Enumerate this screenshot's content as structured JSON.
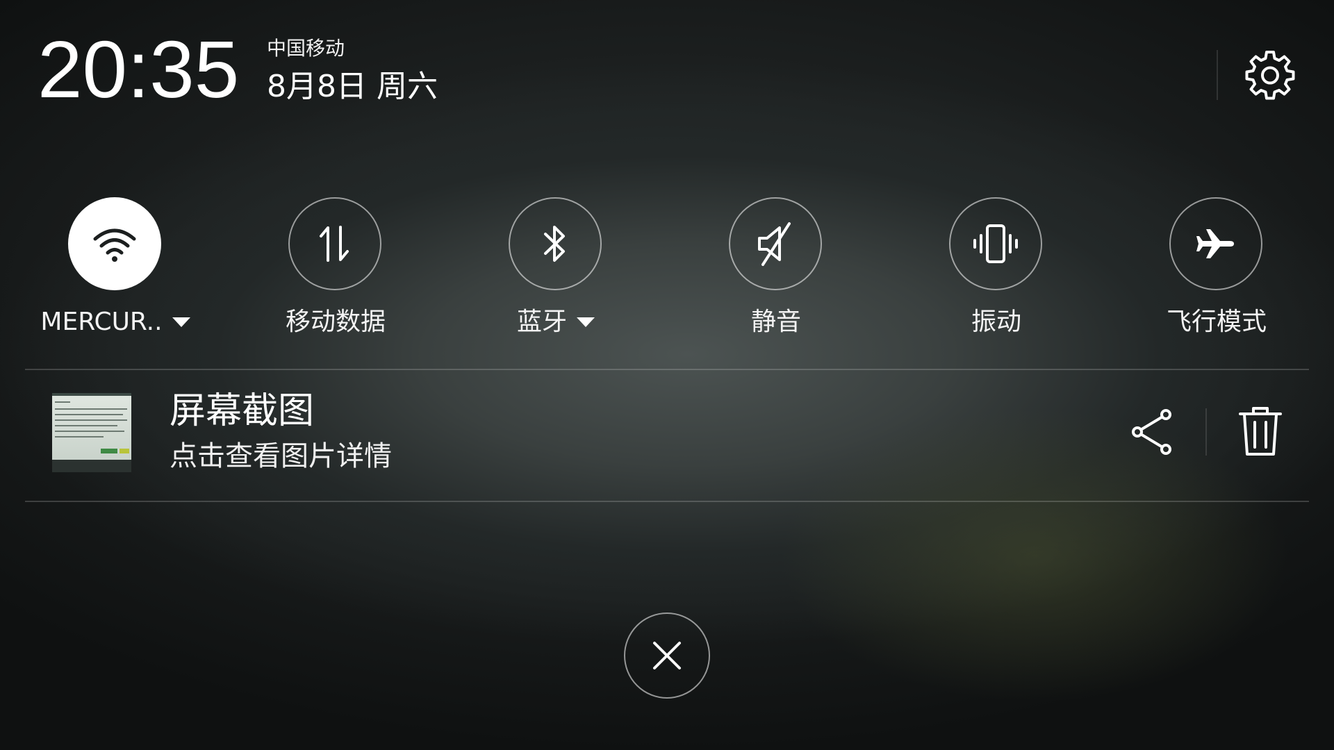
{
  "status": {
    "time": "20:35",
    "carrier": "中国移动",
    "date": "8月8日 周六"
  },
  "header": {
    "settings_icon": "gear-icon"
  },
  "toggles": [
    {
      "id": "wifi",
      "label": "MERCUR..",
      "icon": "wifi-icon",
      "active": true,
      "has_dropdown": true
    },
    {
      "id": "mobile-data",
      "label": "移动数据",
      "icon": "mobile-data-icon",
      "active": false,
      "has_dropdown": false
    },
    {
      "id": "bluetooth",
      "label": "蓝牙",
      "icon": "bluetooth-icon",
      "active": false,
      "has_dropdown": true
    },
    {
      "id": "mute",
      "label": "静音",
      "icon": "mute-icon",
      "active": false,
      "has_dropdown": false
    },
    {
      "id": "vibrate",
      "label": "振动",
      "icon": "vibrate-icon",
      "active": false,
      "has_dropdown": false
    },
    {
      "id": "airplane",
      "label": "飞行模式",
      "icon": "airplane-icon",
      "active": false,
      "has_dropdown": false
    }
  ],
  "notification": {
    "title": "屏幕截图",
    "subtitle": "点击查看图片详情",
    "actions": [
      "share-icon",
      "trash-icon"
    ]
  },
  "close_icon": "close-icon",
  "colors": {
    "active_toggle": "#ffffff",
    "text": "#ffffff",
    "background": "#121414"
  }
}
